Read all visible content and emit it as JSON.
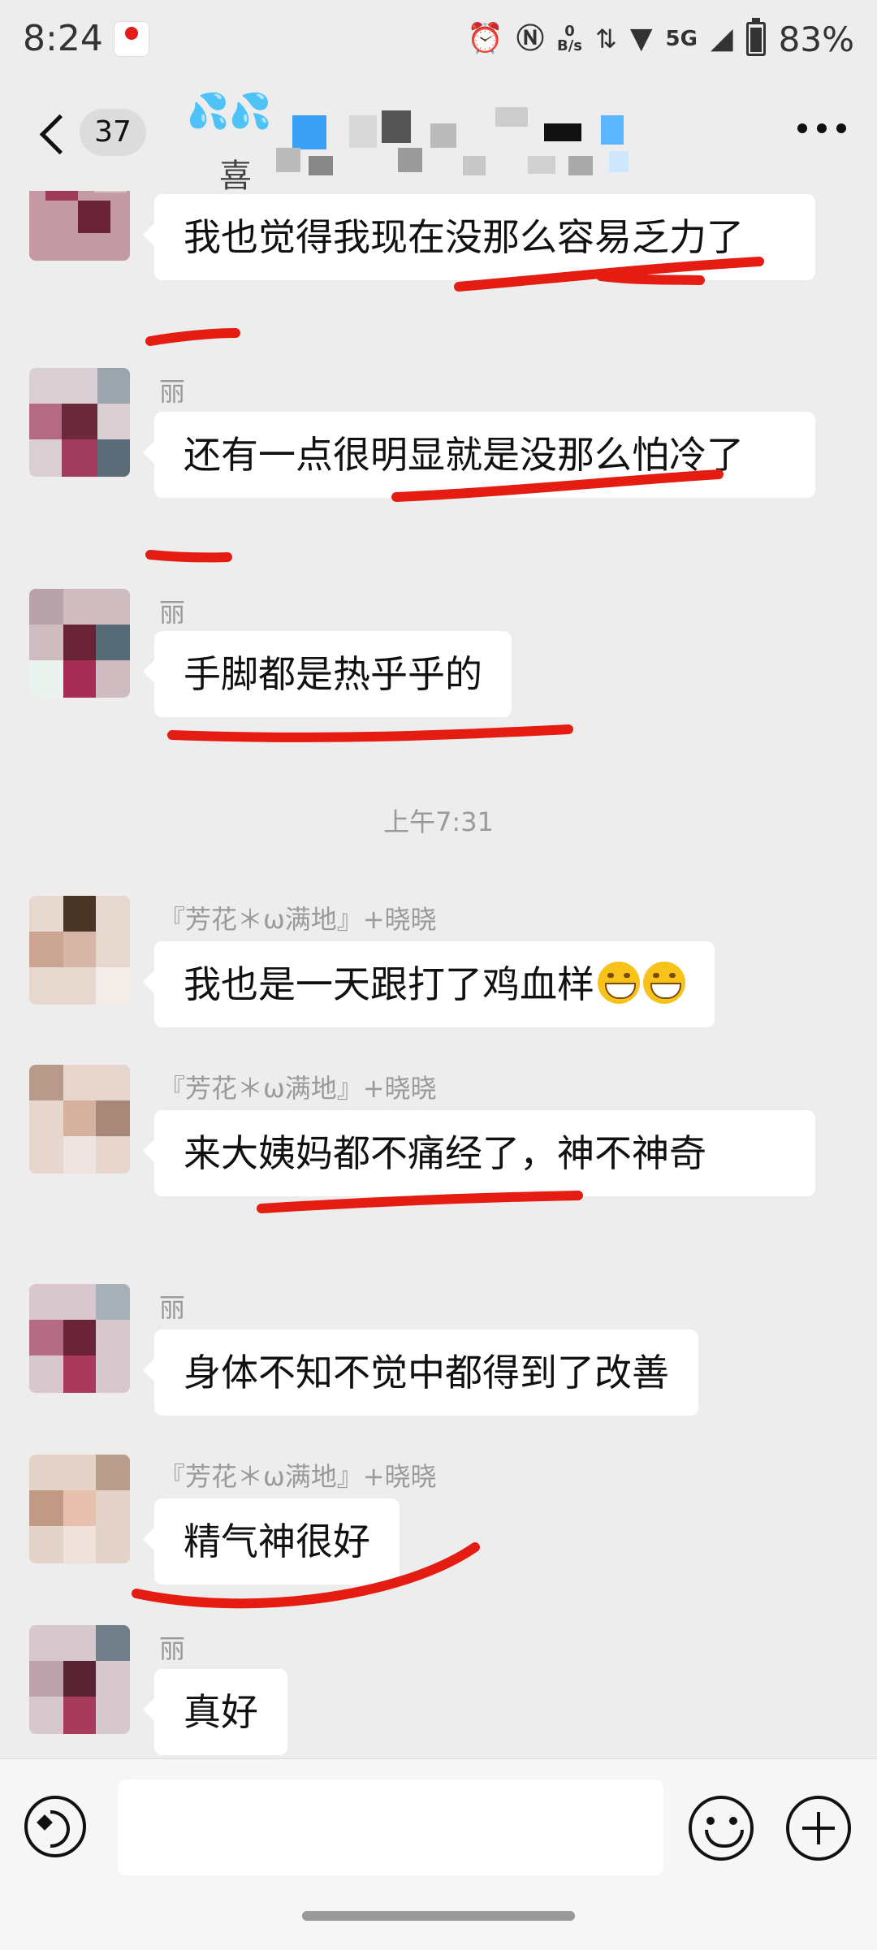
{
  "status_bar": {
    "time": "8:24",
    "network_speed": "0\nB/s",
    "signal_type": "5G",
    "battery_percent": "83%",
    "battery_level": 0.83,
    "icons": [
      "alarm-icon",
      "nfc-icon",
      "network-speed-icon",
      "data-icon",
      "wifi-icon",
      "signal-icon",
      "battery-icon"
    ]
  },
  "header": {
    "unread_count": "37",
    "title_emoji": "💦💦",
    "title_visible_char": "喜"
  },
  "messages": [
    {
      "sender": "",
      "text": "我也觉得我现在没那么容易乏力了"
    },
    {
      "sender": "丽",
      "text": "还有一点很明显就是没那么怕冷了"
    },
    {
      "sender": "丽",
      "text": "手脚都是热乎乎的"
    },
    {
      "timestamp": "上午7:31"
    },
    {
      "sender": "『芳花＊ω满地』+晓晓",
      "text": "我也是一天跟打了鸡血样",
      "emoji": "grin-emoji"
    },
    {
      "sender": "『芳花＊ω满地』+晓晓",
      "text": "来大姨妈都不痛经了，神不神奇"
    },
    {
      "sender": "丽",
      "text": "身体不知不觉中都得到了改善"
    },
    {
      "sender": "『芳花＊ω满地』+晓晓",
      "text": "精气神很好"
    },
    {
      "sender": "丽",
      "text": "真好"
    }
  ],
  "input_bar": {
    "text_value": "",
    "icons": [
      "voice-icon",
      "emoji-icon",
      "plus-icon"
    ]
  },
  "colors": {
    "background": "#ededed",
    "bubble": "#ffffff",
    "annotation": "#e41c12",
    "sender_text": "#9a9a9a"
  }
}
